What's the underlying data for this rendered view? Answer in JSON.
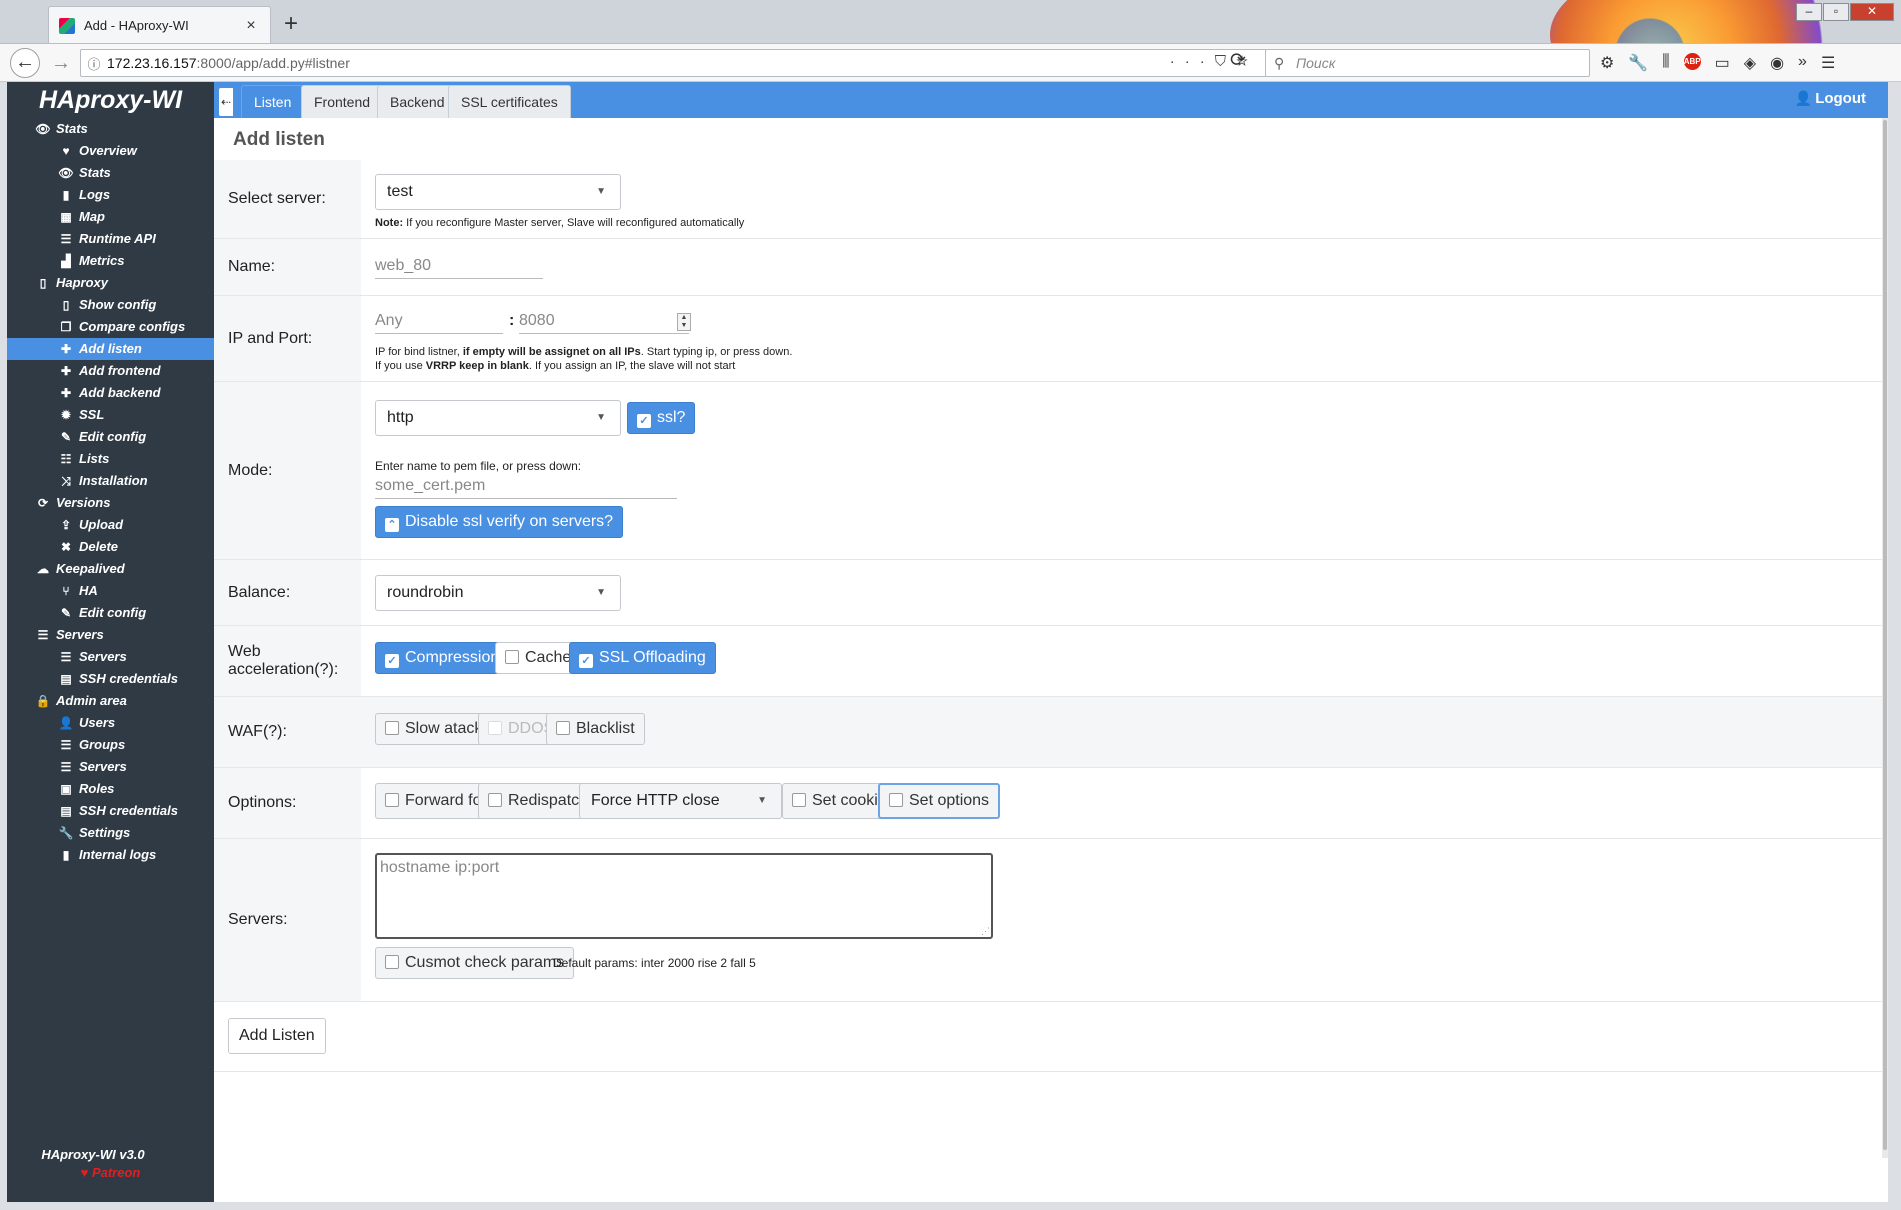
{
  "browser": {
    "tab_title": "Add - HAproxy-WI",
    "tab_close": "×",
    "new_tab": "+",
    "url_host": "172.23.16.157",
    "url_rest": ":8000/app/add.py#listner",
    "search_placeholder": "Поиск"
  },
  "sidebar": {
    "brand": "HAproxy-WI",
    "items": [
      {
        "label": "Stats",
        "icon": "eye-icon",
        "glyph": "👁",
        "level": "top"
      },
      {
        "label": "Overview",
        "icon": "heart-icon",
        "glyph": "♥",
        "level": "sub"
      },
      {
        "label": "Stats",
        "icon": "eye-icon",
        "glyph": "👁",
        "level": "sub"
      },
      {
        "label": "Logs",
        "icon": "book-icon",
        "glyph": "▮",
        "level": "sub"
      },
      {
        "label": "Map",
        "icon": "map-icon",
        "glyph": "▦",
        "level": "sub"
      },
      {
        "label": "Runtime API",
        "icon": "server-icon",
        "glyph": "☰",
        "level": "sub"
      },
      {
        "label": "Metrics",
        "icon": "chart-icon",
        "glyph": "▟",
        "level": "sub"
      },
      {
        "label": "Haproxy",
        "icon": "file-icon",
        "glyph": "▯",
        "level": "top"
      },
      {
        "label": "Show config",
        "icon": "file-icon",
        "glyph": "▯",
        "level": "sub"
      },
      {
        "label": "Compare configs",
        "icon": "copy-icon",
        "glyph": "❐",
        "level": "sub"
      },
      {
        "label": "Add listen",
        "icon": "plus-icon",
        "glyph": "✚",
        "level": "sub",
        "active": true
      },
      {
        "label": "Add frontend",
        "icon": "plus-icon",
        "glyph": "✚",
        "level": "sub"
      },
      {
        "label": "Add backend",
        "icon": "plus-icon",
        "glyph": "✚",
        "level": "sub"
      },
      {
        "label": "SSL",
        "icon": "certificate-icon",
        "glyph": "✹",
        "level": "sub"
      },
      {
        "label": "Edit config",
        "icon": "edit-icon",
        "glyph": "✎",
        "level": "sub"
      },
      {
        "label": "Lists",
        "icon": "list-icon",
        "glyph": "☷",
        "level": "sub"
      },
      {
        "label": "Installation",
        "icon": "shuffle-icon",
        "glyph": "⤨",
        "level": "sub"
      },
      {
        "label": "Versions",
        "icon": "sync-icon",
        "glyph": "⟳",
        "level": "top"
      },
      {
        "label": "Upload",
        "icon": "upload-icon",
        "glyph": "⇪",
        "level": "sub"
      },
      {
        "label": "Delete",
        "icon": "x-icon",
        "glyph": "✖",
        "level": "sub"
      },
      {
        "label": "Keepalived",
        "icon": "cloud-icon",
        "glyph": "☁",
        "level": "top"
      },
      {
        "label": "HA",
        "icon": "branch-icon",
        "glyph": "⑂",
        "level": "sub"
      },
      {
        "label": "Edit config",
        "icon": "edit-icon",
        "glyph": "✎",
        "level": "sub"
      },
      {
        "label": "Servers",
        "icon": "server-icon",
        "glyph": "☰",
        "level": "top"
      },
      {
        "label": "Servers",
        "icon": "server-icon",
        "glyph": "☰",
        "level": "sub"
      },
      {
        "label": "SSH credentials",
        "icon": "database-icon",
        "glyph": "▤",
        "level": "sub"
      },
      {
        "label": "Admin area",
        "icon": "lock-icon",
        "glyph": "🔒",
        "level": "top"
      },
      {
        "label": "Users",
        "icon": "user-plus-icon",
        "glyph": "👤",
        "level": "sub"
      },
      {
        "label": "Groups",
        "icon": "server-icon",
        "glyph": "☰",
        "level": "sub"
      },
      {
        "label": "Servers",
        "icon": "server-icon",
        "glyph": "☰",
        "level": "sub"
      },
      {
        "label": "Roles",
        "icon": "user-card-icon",
        "glyph": "▣",
        "level": "sub"
      },
      {
        "label": "SSH credentials",
        "icon": "database-icon",
        "glyph": "▤",
        "level": "sub"
      },
      {
        "label": "Settings",
        "icon": "wrench-icon",
        "glyph": "🔧",
        "level": "sub"
      },
      {
        "label": "Internal logs",
        "icon": "book-icon",
        "glyph": "▮",
        "level": "sub"
      }
    ],
    "version": "HAproxy-WI v3.0",
    "patreon": "♥ Patreon"
  },
  "topbar": {
    "collapse": "⇠",
    "tabs": [
      "Listen",
      "Frontend",
      "Backend",
      "SSL certificates"
    ],
    "logout": "Logout"
  },
  "form": {
    "title": "Add listen",
    "select_server": {
      "label": "Select server:",
      "value": "test",
      "note_bold": "Note:",
      "note": " If you reconfigure Master server, Slave will reconfigured automatically"
    },
    "name": {
      "label": "Name:",
      "placeholder": "web_80"
    },
    "ip_port": {
      "label": "IP and Port:",
      "ip_placeholder": "Any",
      "colon": ":",
      "port_placeholder": "8080",
      "help1_a": "IP for bind listner, ",
      "help1_b": "if empty will be assignet on all IPs",
      "help1_c": ". Start typing ip, or press down.",
      "help2_a": "If you use ",
      "help2_b": "VRRP keep in blank",
      "help2_c": ". If you assign an IP, the slave will not start"
    },
    "mode": {
      "label": "Mode:",
      "value": "http",
      "ssl_label": "ssl?",
      "pem_label": "Enter name to pem file, or press down:",
      "pem_placeholder": "some_cert.pem",
      "disable_ssl_verify": "Disable ssl verify on servers?"
    },
    "balance": {
      "label": "Balance:",
      "value": "roundrobin"
    },
    "web_accel": {
      "label": "Web acceleration(?):",
      "options": [
        {
          "label": "Compression",
          "checked": true
        },
        {
          "label": "Cache",
          "checked": false
        },
        {
          "label": "SSL Offloading",
          "checked": true
        }
      ]
    },
    "waf": {
      "label": "WAF(?):",
      "options": [
        {
          "label": "Slow atack",
          "disabled": false
        },
        {
          "label": "DDOS",
          "disabled": true
        },
        {
          "label": "Blacklist",
          "disabled": false
        }
      ]
    },
    "options": {
      "label": "Optinons:",
      "forward_for": "Forward for",
      "redispatch": "Redispatch",
      "http_close": "Force HTTP close",
      "set_cookie": "Set cookie",
      "set_options": "Set options"
    },
    "servers": {
      "label": "Servers:",
      "placeholder": "hostname ip:port",
      "custom_check": "Cusmot check params",
      "default_params": "Default params: inter 2000 rise 2 fall 5"
    },
    "submit": "Add Listen"
  },
  "colors": {
    "accent": "#4a90e2",
    "sidebar": "#2f3a45",
    "active": "#4a90e2",
    "patreon": "#e02020"
  }
}
